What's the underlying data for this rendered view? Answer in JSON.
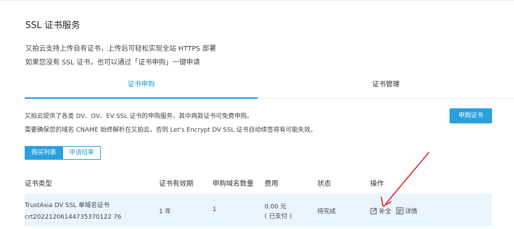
{
  "page": {
    "title": "SSL 证书服务",
    "desc_line1": "又拍云支持上传自有证书，上传后可轻松实现全站 HTTPS 部署",
    "desc_line2": "如果您没有 SSL 证书，也可以通过「证书申购」一键申请"
  },
  "tabs": [
    {
      "label": "证书申购",
      "active": true
    },
    {
      "label": "证书管理",
      "active": false
    }
  ],
  "purchase": {
    "info_line1": "又拍云提供了各类 DV、OV、EV SSL 证书的申购服务，其中两款证书可免费申购。",
    "info_line2": "需要确保您的域名 CNAME 始终解析在又拍云，否则 Let's Encrypt DV SSL 证书自动续签将有可能失效。",
    "apply_button": "申购证书",
    "subtabs": [
      {
        "label": "购买列表",
        "active": true
      },
      {
        "label": "申请结果",
        "active": false
      }
    ]
  },
  "table": {
    "headers": [
      "证书类型",
      "证书有效期",
      "申购域名数量",
      "费用",
      "状态",
      "操作"
    ],
    "rows": [
      {
        "cert_type": "TrustAsia DV SSL 单域名证书",
        "cert_id": "crt20221206144735370122 76",
        "validity": "1 年",
        "domain_count": "1",
        "fee": "0.00 元",
        "fee_status": "( 已支付 )",
        "status": "待完成",
        "actions": [
          {
            "label": "补全",
            "icon": "edit-icon"
          },
          {
            "label": "详情",
            "icon": "detail-icon"
          }
        ]
      }
    ]
  },
  "colors": {
    "accent": "#2aa0dd",
    "tab_active": "#1d9bd7",
    "row_bg": "#eaf4fc",
    "annotation_arrow": "#e02020"
  }
}
